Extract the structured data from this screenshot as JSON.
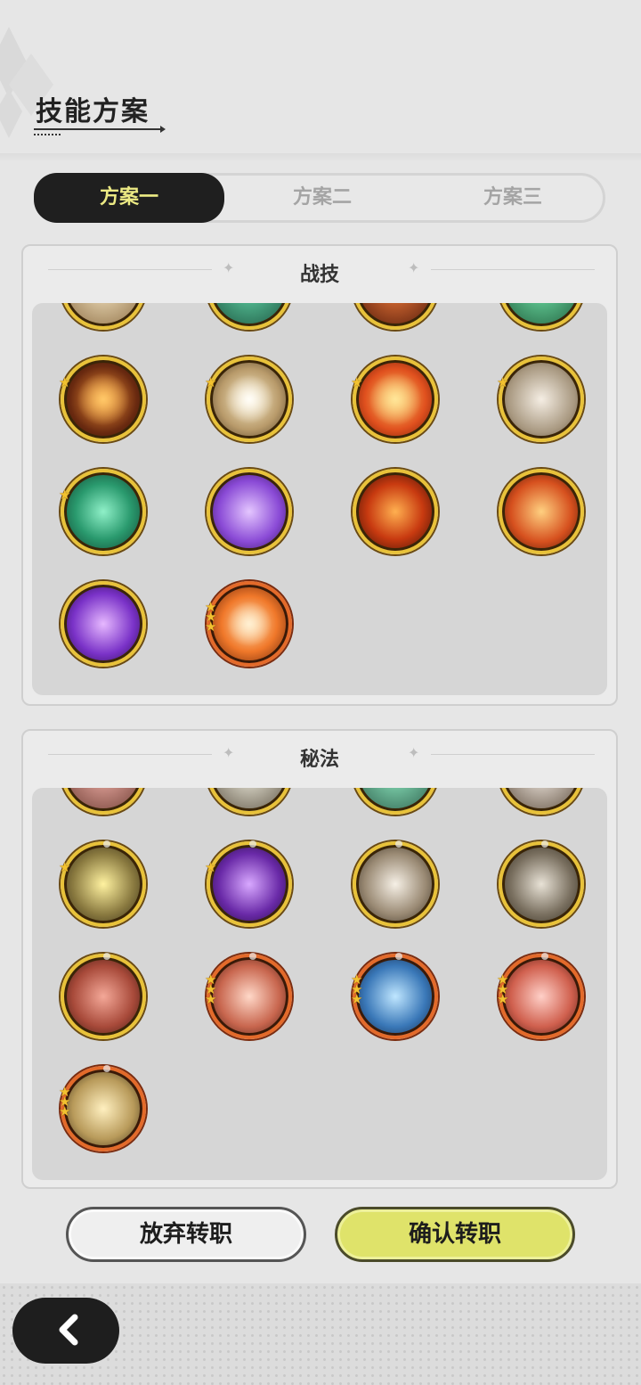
{
  "header": {
    "title": "技能方案"
  },
  "tabs": [
    {
      "label": "方案一",
      "active": true
    },
    {
      "label": "方案二",
      "active": false
    },
    {
      "label": "方案三",
      "active": false
    }
  ],
  "sections": {
    "combat": {
      "title": "战技"
    },
    "secret": {
      "title": "秘法"
    }
  },
  "buttons": {
    "cancel": "放弃转职",
    "confirm": "确认转职"
  },
  "icons": {
    "back": "chevron-left-icon",
    "tab_star": "sparkle-icon"
  },
  "colors": {
    "active_tab_bg": "#1f1f1f",
    "active_tab_text": "#ecea84",
    "confirm_button": "#dfe36a",
    "gold_frame": "#e8c23a",
    "orange_frame": "#e36a2a"
  }
}
